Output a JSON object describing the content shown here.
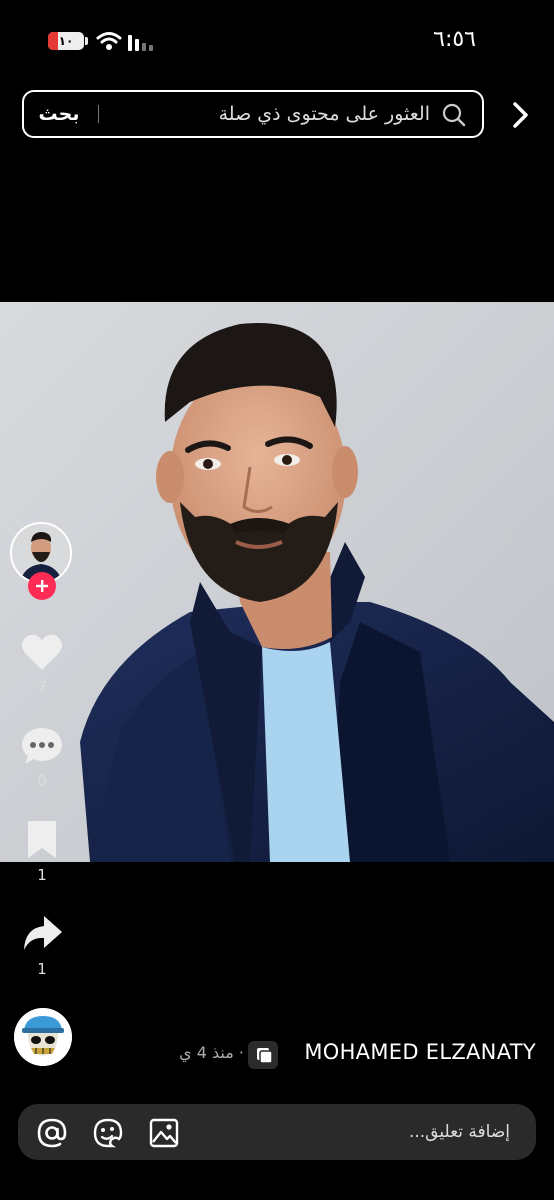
{
  "status_bar": {
    "battery_level": "١٠",
    "time": "٦:٥٦"
  },
  "search": {
    "placeholder": "العثور على محتوى ذي صلة",
    "button_label": "بحث"
  },
  "actions": {
    "likes": "7",
    "comments": "0",
    "saves": "1",
    "shares": "1"
  },
  "post": {
    "author_name": "MOHAMED ELZANATY",
    "time_ago": "· منذ 4 ي"
  },
  "comment_box": {
    "placeholder": "إضافة تعليق..."
  },
  "colors": {
    "accent": "#fe2c55",
    "background": "#000000",
    "comment_bar": "#2a2a2a"
  }
}
